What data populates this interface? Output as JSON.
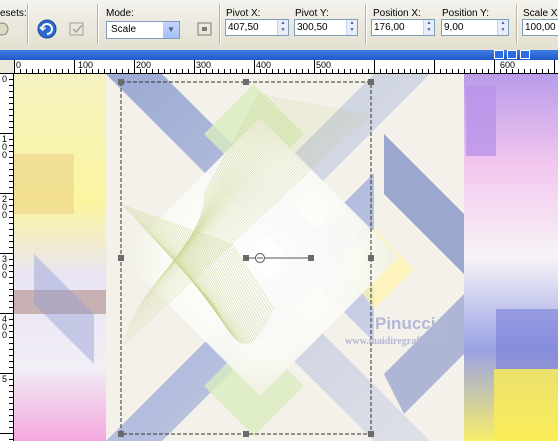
{
  "toolbar": {
    "presets_label": "esets:",
    "mode_label": "Mode:",
    "mode_value": "Scale",
    "pivot_x_label": "Pivot X:",
    "pivot_x_value": "407,50",
    "pivot_y_label": "Pivot Y:",
    "pivot_y_value": "300,50",
    "position_x_label": "Position X:",
    "position_x_value": "176,00",
    "position_y_label": "Position Y:",
    "position_y_value": "9,00",
    "scale_x_label": "Scale X(",
    "scale_x_value": "100,00"
  },
  "ruler": {
    "top_labels": [
      "0",
      "100",
      "200",
      "300",
      "400",
      "500",
      "600"
    ],
    "left_labels": [
      "0",
      "1\n0\n0",
      "2\n0\n0",
      "3\n0\n0",
      "4\n0\n0",
      "5"
    ]
  },
  "watermark": {
    "name": "Pinuccia",
    "site": "www.maidiregrafica.eu"
  },
  "colors": {
    "toolbar_bg": "#ece9d8",
    "titlebar": "#2358c8",
    "bbox_handle": "#6b6b6b",
    "pivot_line": "#555555"
  }
}
